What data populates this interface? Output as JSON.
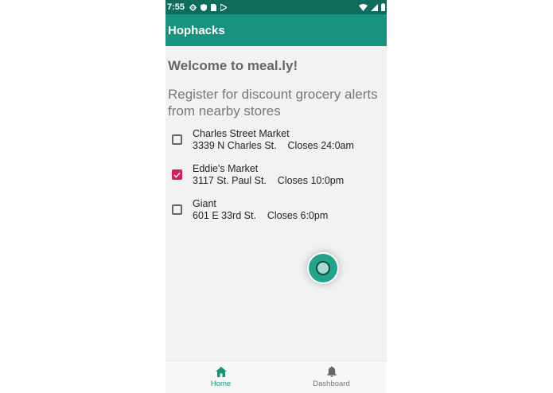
{
  "status_bar": {
    "time": "7:55",
    "icons_left": [
      "gear-icon",
      "shield-icon",
      "sim-card-icon",
      "play-store-icon"
    ],
    "icons_right": [
      "wifi-icon",
      "signal-icon",
      "battery-icon"
    ]
  },
  "app_bar": {
    "title": "Hophacks"
  },
  "main": {
    "welcome": "Welcome to meal.ly!",
    "subtitle": "Register for discount grocery alerts from nearby stores",
    "stores": [
      {
        "name": "Charles Street Market",
        "address": "3339 N Charles St.",
        "closes": "Closes 24:0am",
        "checked": false
      },
      {
        "name": "Eddie's Market",
        "address": "3117 St. Paul St.",
        "closes": "Closes 10:0pm",
        "checked": true
      },
      {
        "name": "Giant",
        "address": "601 E 33rd St.",
        "closes": "Closes 6:0pm",
        "checked": false
      }
    ]
  },
  "bottom_nav": {
    "items": [
      {
        "label": "Home",
        "icon": "home-icon",
        "active": true
      },
      {
        "label": "Dashboard",
        "icon": "bell-icon",
        "active": false
      }
    ]
  },
  "colors": {
    "status_bar": "#0f6b5c",
    "app_bar": "#17937e",
    "accent": "#d81b60",
    "nav_active": "#17937e",
    "nav_inactive": "#777777"
  }
}
